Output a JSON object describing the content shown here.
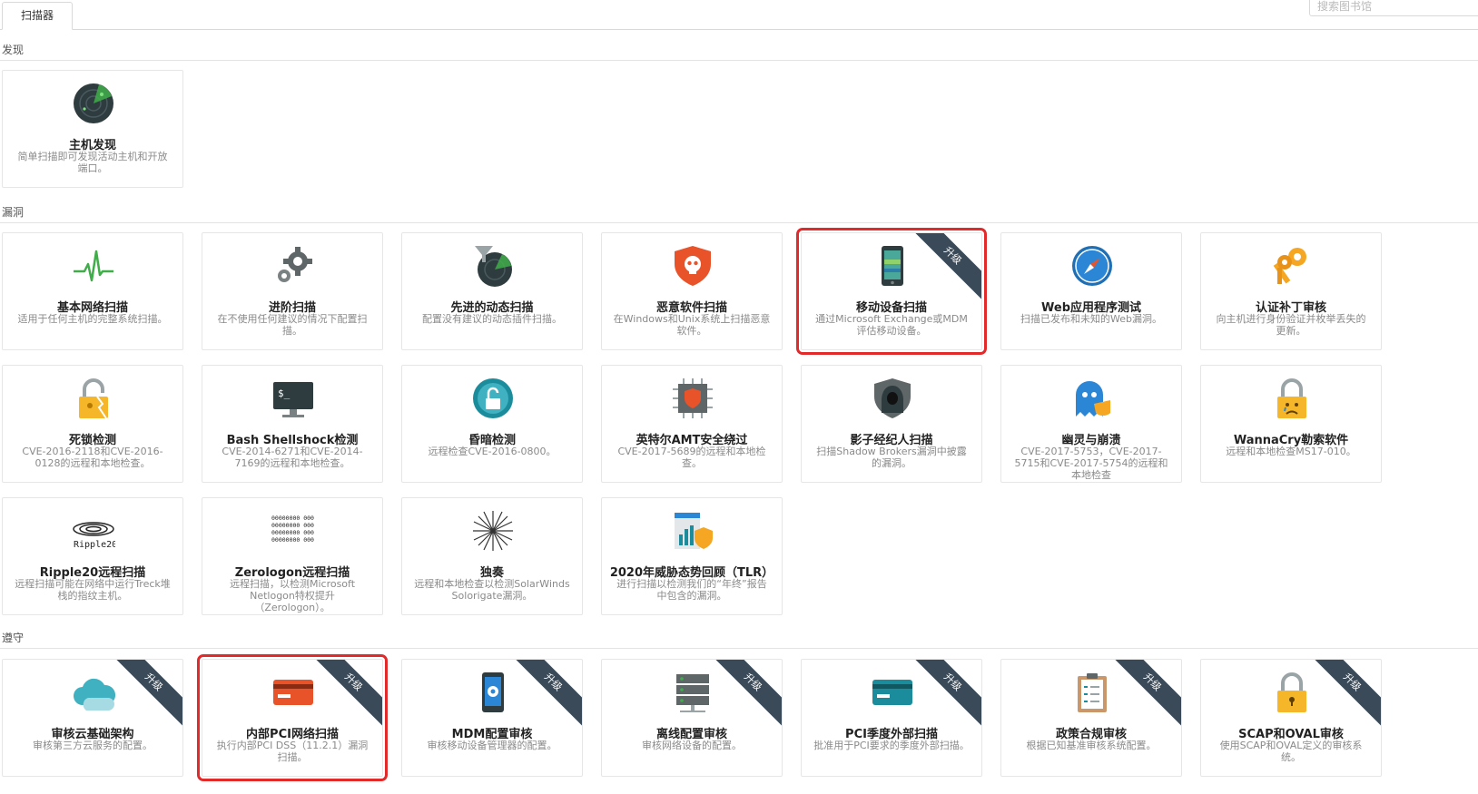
{
  "tab_label": "扫描器",
  "search_placeholder": "搜索图书馆",
  "sections": {
    "discovery": "发现",
    "vulnerabilities": "漏洞",
    "compliance": "遵守"
  },
  "upgrade_label": "升级",
  "cards": {
    "host_discovery": {
      "title": "主机发现",
      "desc": "简单扫描即可发现活动主机和开放端口。"
    },
    "basic_network": {
      "title": "基本网络扫描",
      "desc": "适用于任何主机的完整系统扫描。"
    },
    "advanced_scan": {
      "title": "进阶扫描",
      "desc": "在不使用任何建议的情况下配置扫描。"
    },
    "advanced_dynamic": {
      "title": "先进的动态扫描",
      "desc": "配置没有建议的动态插件扫描。"
    },
    "malware": {
      "title": "恶意软件扫描",
      "desc": "在Windows和Unix系统上扫描恶意软件。"
    },
    "mobile_device": {
      "title": "移动设备扫描",
      "desc": "通过Microsoft Exchange或MDM评估移动设备。"
    },
    "web_app": {
      "title": "Web应用程序测试",
      "desc": "扫描已发布和未知的Web漏洞。"
    },
    "patch_audit": {
      "title": "认证补丁审核",
      "desc": "向主机进行身份验证并枚举丢失的更新。"
    },
    "deadlock": {
      "title": "死锁检测",
      "desc": "CVE-2016-2118和CVE-2016-0128的远程和本地检查。"
    },
    "shellshock": {
      "title": "Bash Shellshock检测",
      "desc": "CVE-2014-6271和CVE-2014-7169的远程和本地检查。"
    },
    "dim": {
      "title": "昏暗检测",
      "desc": "远程检查CVE-2016-0800。"
    },
    "intel_amt": {
      "title": "英特尔AMT安全绕过",
      "desc": "CVE-2017-5689的远程和本地检查。"
    },
    "shadow_brokers": {
      "title": "影子经纪人扫描",
      "desc": "扫描Shadow Brokers漏洞中披露的漏洞。"
    },
    "spectre": {
      "title": "幽灵与崩溃",
      "desc": "CVE-2017-5753，CVE-2017-5715和CVE-2017-5754的远程和本地检查"
    },
    "wannacry": {
      "title": "WannaCry勒索软件",
      "desc": "远程和本地检查MS17-010。"
    },
    "ripple20": {
      "title": "Ripple20远程扫描",
      "desc": "远程扫描可能在网络中运行Treck堆栈的指纹主机。"
    },
    "zerologon": {
      "title": "Zerologon远程扫描",
      "desc": "远程扫描，以检测Microsoft Netlogon特权提升（Zerologon）。"
    },
    "solorigate": {
      "title": "独奏",
      "desc": "远程和本地检查以检测SolarWinds Solorigate漏洞。"
    },
    "tlr2020": {
      "title": "2020年威胁态势回顾（TLR）",
      "desc": "进行扫描以检测我们的“年终”报告中包含的漏洞。"
    },
    "cloud_audit": {
      "title": "审核云基础架构",
      "desc": "审核第三方云服务的配置。"
    },
    "internal_pci": {
      "title": "内部PCI网络扫描",
      "desc": "执行内部PCI DSS（11.2.1）漏洞扫描。"
    },
    "mdm_audit": {
      "title": "MDM配置审核",
      "desc": "审核移动设备管理器的配置。"
    },
    "offline_audit": {
      "title": "离线配置审核",
      "desc": "审核网络设备的配置。"
    },
    "pci_external": {
      "title": "PCI季度外部扫描",
      "desc": "批准用于PCI要求的季度外部扫描。"
    },
    "policy_audit": {
      "title": "政策合规审核",
      "desc": "根据已知基准审核系统配置。"
    },
    "scap_oval": {
      "title": "SCAP和OVAL审核",
      "desc": "使用SCAP和OVAL定义的审核系统。"
    }
  },
  "colors": {
    "highlight": "#e32a2a",
    "ribbon": "#3b4a58",
    "accent_orange": "#f5a623",
    "accent_teal": "#1a8c9c"
  }
}
